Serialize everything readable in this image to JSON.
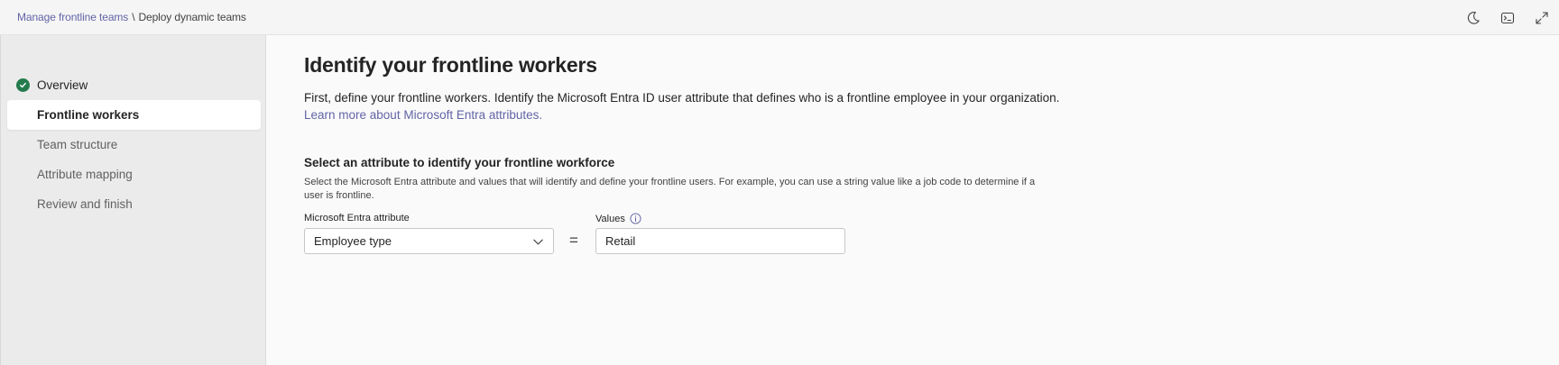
{
  "breadcrumb": {
    "parent": "Manage frontline teams",
    "separator": "\\",
    "current": "Deploy dynamic teams"
  },
  "top_actions": [
    "moon-icon",
    "terminal-icon",
    "expand-icon"
  ],
  "sidebar": {
    "items": [
      {
        "label": "Overview",
        "state": "completed"
      },
      {
        "label": "Frontline workers",
        "state": "active"
      },
      {
        "label": "Team structure",
        "state": "pending"
      },
      {
        "label": "Attribute mapping",
        "state": "pending"
      },
      {
        "label": "Review and finish",
        "state": "pending"
      }
    ]
  },
  "main": {
    "title": "Identify your frontline workers",
    "description": "First, define your frontline workers. Identify the Microsoft Entra ID user attribute that defines who is a frontline employee in your organization.",
    "learn_link": "Learn more about Microsoft Entra attributes.",
    "section_title": "Select an attribute to identify your frontline workforce",
    "section_description": "Select the Microsoft Entra attribute and values that will identify and define your frontline users. For example, you can use a string value like a job code to determine if a user is frontline.",
    "attribute_label": "Microsoft Entra attribute",
    "attribute_value": "Employee type",
    "equals": "=",
    "values_label": "Values",
    "values_value": "Retail"
  },
  "colors": {
    "accent": "#6264a7",
    "success": "#237b4b",
    "sidebar_bg": "#ebebeb",
    "page_bg": "#fafafa"
  }
}
